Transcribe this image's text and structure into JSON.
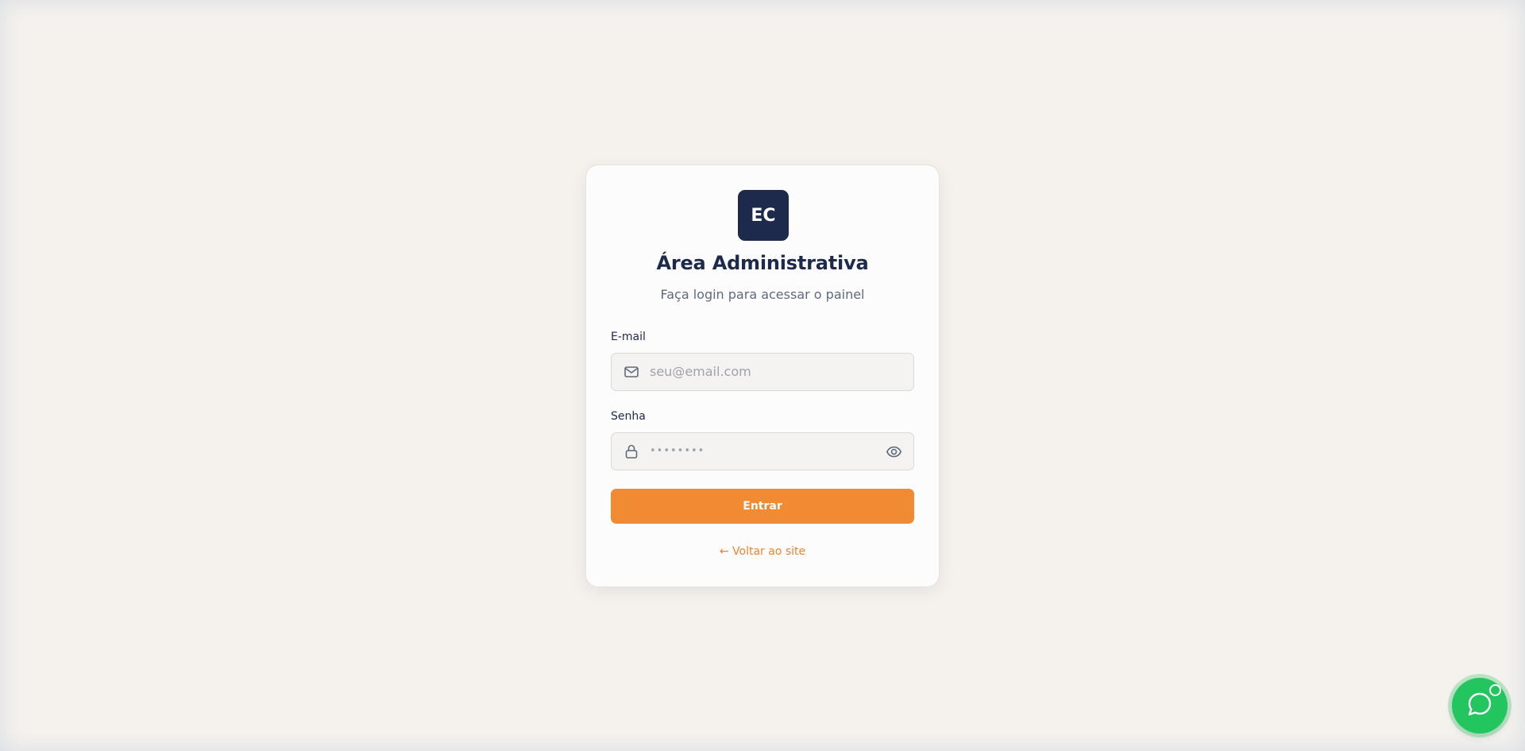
{
  "login": {
    "logo_text": "EC",
    "title": "Área Administrativa",
    "subtitle": "Faça login para acessar o painel",
    "email_label": "E-mail",
    "email_placeholder": "seu@email.com",
    "password_label": "Senha",
    "password_placeholder": "••••••••",
    "submit_label": "Entrar",
    "back_link": "← Voltar ao site"
  },
  "icons": {
    "email": "mail-icon",
    "password": "lock-icon",
    "toggle": "eye-icon",
    "chat": "chat-bubble-icon"
  },
  "colors": {
    "brand_navy": "#1d2a4c",
    "accent_orange": "#f08a33",
    "chat_green": "#22c55e",
    "background": "#f5f2ee"
  }
}
